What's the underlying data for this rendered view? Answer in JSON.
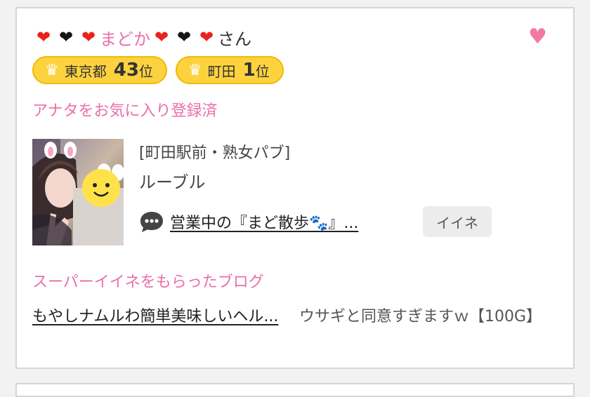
{
  "profile": {
    "name_emoji_left": [
      "❤",
      "❤",
      "❤"
    ],
    "name_emoji_right": [
      "❤",
      "❤",
      "❤"
    ],
    "name": "まどか",
    "honorific": "さん",
    "favorite_icon": "heart-icon",
    "favorite_color": "#f07aa0",
    "name_color": "#ea6fa8"
  },
  "rankings": [
    {
      "area": "東京都",
      "rank": "43",
      "suffix": "位",
      "icon": "crown-icon"
    },
    {
      "area": "町田",
      "rank": "1",
      "suffix": "位",
      "icon": "crown-icon"
    }
  ],
  "favorite_status": "アナタをお気に入り登録済",
  "post": {
    "shop": "[町田駅前・熟女パブ]",
    "store_name": "ルーブル",
    "blog_icon": "speech-bubble-icon",
    "blog_title": "営業中の『まど散歩🐾』...",
    "like_label": "イイネ"
  },
  "super_like": {
    "title": "スーパーイイネをもらったブログ",
    "blog_link": "もやしナムルわ簡単美味しいヘル...",
    "comment": "ウサギと同意すぎますｗ【100G】"
  },
  "colors": {
    "accent_pink": "#ea6fa8",
    "badge_yellow": "#fcd33f",
    "badge_border": "#f2b800"
  }
}
